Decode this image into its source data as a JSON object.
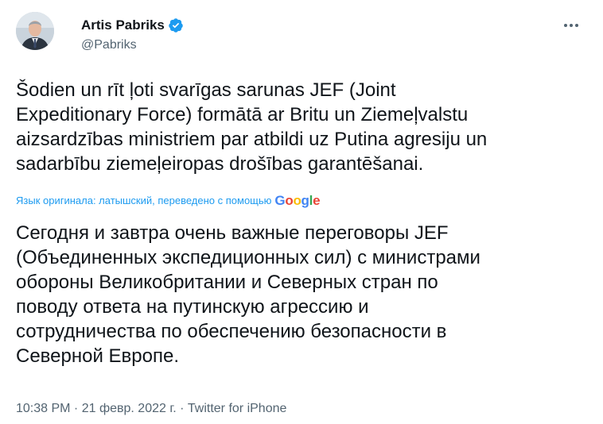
{
  "author": {
    "name": "Artis Pabriks",
    "handle": "@Pabriks",
    "verified": true
  },
  "icons": {
    "avatar": "profile-photo",
    "verified": "verified-badge-icon",
    "more": "more-options-icon"
  },
  "colors": {
    "accent": "#1d9bf0",
    "text": "#0f1419",
    "secondary": "#536471"
  },
  "tweet": {
    "original_text": "Šodien un rīt ļoti svarīgas sarunas JEF (Joint\nExpeditionary Force) formātā ar Britu un Ziemeļvalstu\naizsardzības ministriem par atbildi uz Putina agresiju un\nsadarbību ziemeļeiropas drošības garantēšanai.",
    "translation_note": "Язык оригинала: латышский, переведено с помощью",
    "translation_provider": "Google",
    "translated_text": "Сегодня и завтра очень важные переговоры JEF\n(Объединенных экспедиционных сил) с министрами\nобороны Великобритании и Северных стран по\nповоду ответа на путинскую агрессию и\nсотрудничества по обеспечению безопасности в\nСеверной Европе.",
    "time": "10:38 PM",
    "date": "21 февр. 2022 г.",
    "source": "Twitter for iPhone",
    "separator": " · "
  }
}
